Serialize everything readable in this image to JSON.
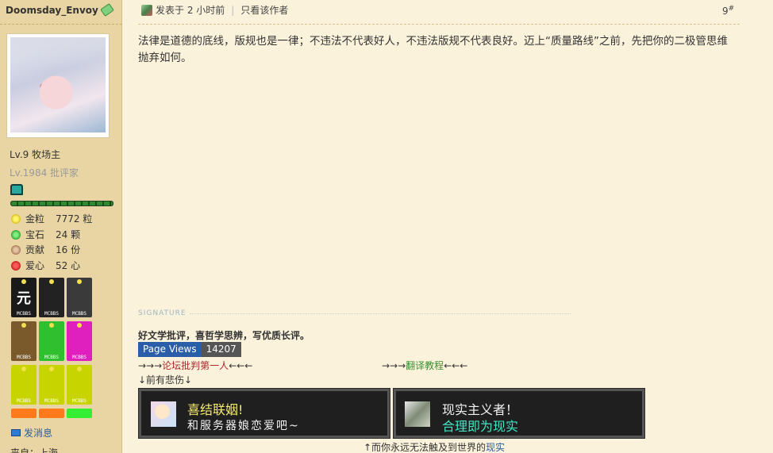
{
  "user": {
    "name": "Doomsday_Envoy",
    "level_line1": "Lv.9 牧场主",
    "level_line2": "Lv.1984 批评家",
    "progress": 1.0,
    "stats": [
      {
        "icon": "gold-nugget-icon",
        "label": "金粒",
        "value": "7772 粒"
      },
      {
        "icon": "gem-icon",
        "label": "宝石",
        "value": "24 颗"
      },
      {
        "icon": "cookie-icon",
        "label": "贡献",
        "value": "16 份"
      },
      {
        "icon": "apple-icon",
        "label": "爱心",
        "value": "52 心"
      }
    ],
    "medals": [
      {
        "icon": "yuan-medal-icon",
        "glyph": "元",
        "text": "MCBBS",
        "bg": "#1a1a1a"
      },
      {
        "icon": "cobweb-medal-icon",
        "glyph": "",
        "text": "MCBBS",
        "bg": "#222222"
      },
      {
        "icon": "ender-medal-icon",
        "glyph": "",
        "text": "MCBBS",
        "bg": "#3a3a3a"
      },
      {
        "icon": "book-medal-icon",
        "glyph": "",
        "text": "MCBBS",
        "bg": "#7a5a2a"
      },
      {
        "icon": "bookshelf-medal-icon",
        "glyph": "",
        "text": "MCBBS",
        "bg": "#2fbf2f"
      },
      {
        "icon": "green-apple-medal-icon",
        "glyph": "",
        "text": "MCBBS",
        "bg": "#e01fbf"
      },
      {
        "icon": "pickaxe-medal-icon",
        "glyph": "",
        "text": "MCBBS",
        "bg": "#c7d400"
      },
      {
        "icon": "pickaxe-medal-icon-2",
        "glyph": "",
        "text": "MCBBS",
        "bg": "#c7d400"
      },
      {
        "icon": "pickaxe-medal-icon-3",
        "glyph": "",
        "text": "MCBBS",
        "bg": "#c7d400"
      },
      {
        "icon": "orange-medal-icon",
        "glyph": "",
        "text": "",
        "bg": "#ff7a1a"
      },
      {
        "icon": "orange-medal-icon-2",
        "glyph": "",
        "text": "",
        "bg": "#ff7a1a"
      },
      {
        "icon": "green-medal-icon",
        "glyph": "",
        "text": "",
        "bg": "#33ee33"
      }
    ],
    "pm_label": "发消息",
    "from_text": "来自：上海"
  },
  "post": {
    "posted_time": "发表于 2 小时前",
    "only_author": "只看该作者",
    "floor_number": "9",
    "floor_sup": "#",
    "content": "法律是道德的底线，版规也是一律；不违法不代表好人，不违法版规不代表良好。迈上“质量路线”之前，先把你的二极管思维抛弃如何。"
  },
  "signature": {
    "heading": "SIGNATURE",
    "motto": "好文学批评，喜哲学思辨，写优质长评。",
    "page_views_label": "Page Views",
    "page_views_count": "14207",
    "link1_prefix": "→→→",
    "link1_text": "论坛批判第一人",
    "link1_suffix": "←←←",
    "link2_prefix": "→→→",
    "link2_text": "翻译教程",
    "link2_suffix": "←←←",
    "sad_line": "↓前有悲伤↓",
    "banner1_line1": "喜结联姻!",
    "banner1_line2": "和服务器娘恋爱吧~",
    "banner2_line1": "现实主义者！",
    "banner2_line2": "合理即为现实",
    "bottom_prefix": "↑而你永远无法触及到世界的",
    "bottom_link": "现实"
  },
  "colors": {
    "sidebar_bg": "#e9d5a3",
    "page_bg": "#fbf2db",
    "link_blue": "#2a5c9a",
    "link_red": "#b2222e",
    "link_green": "#3a8f2e"
  }
}
